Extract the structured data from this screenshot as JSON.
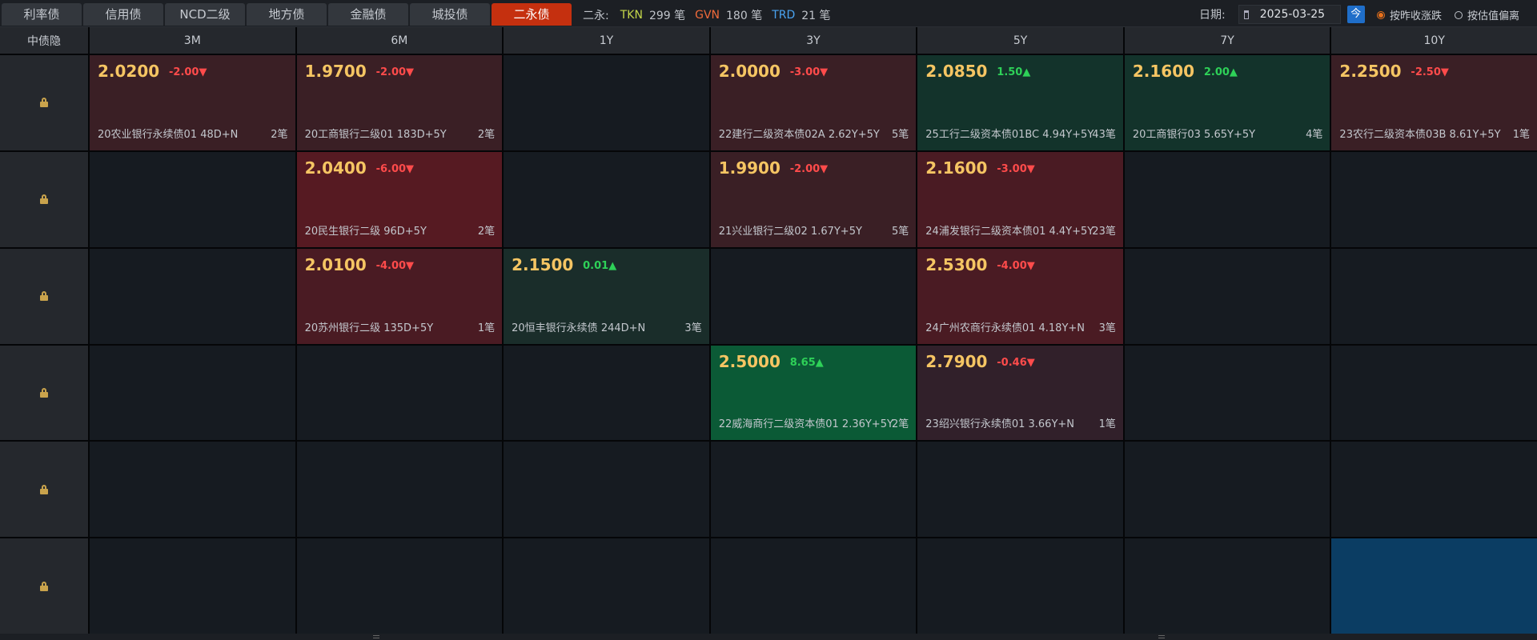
{
  "tabs": [
    {
      "label": "利率债",
      "active": false
    },
    {
      "label": "信用债",
      "active": false
    },
    {
      "label": "NCD二级",
      "active": false
    },
    {
      "label": "地方债",
      "active": false
    },
    {
      "label": "金融债",
      "active": false
    },
    {
      "label": "城投债",
      "active": false
    },
    {
      "label": "二永债",
      "active": true
    }
  ],
  "summary": {
    "label": "二永:",
    "items": [
      {
        "code": "TKN",
        "count": "299 笔",
        "color": "#c4d64a"
      },
      {
        "code": "GVN",
        "count": "180 笔",
        "color": "#f06a3a"
      },
      {
        "code": "TRD",
        "count": "21 笔",
        "color": "#4aa3f0"
      }
    ]
  },
  "date": {
    "label": "日期:",
    "value": "2025-03-25",
    "today_label": "今"
  },
  "radios": [
    {
      "label": "按昨收涨跌",
      "checked": true
    },
    {
      "label": "按估值偏离",
      "checked": false
    }
  ],
  "columns": [
    "中债隐",
    "3M",
    "6M",
    "1Y",
    "3Y",
    "5Y",
    "7Y",
    "10Y"
  ],
  "rows": [
    [
      {
        "price": "2.0200",
        "change": "-2.00▼",
        "dir": "neg",
        "name": "20农业银行永续债01 48D+N",
        "count": "2笔",
        "tone": "r1"
      },
      {
        "price": "1.9700",
        "change": "-2.00▼",
        "dir": "neg",
        "name": "20工商银行二级01 183D+5Y",
        "count": "2笔",
        "tone": "r1"
      },
      null,
      {
        "price": "2.0000",
        "change": "-3.00▼",
        "dir": "neg",
        "name": "22建行二级资本债02A 2.62Y+5Y",
        "count": "5笔",
        "tone": "r1"
      },
      {
        "price": "2.0850",
        "change": "1.50▲",
        "dir": "pos",
        "name": "25工行二级资本债01BC 4.94Y+5Y",
        "count": "43笔",
        "tone": "g1"
      },
      {
        "price": "2.1600",
        "change": "2.00▲",
        "dir": "pos",
        "name": "20工商银行03 5.65Y+5Y",
        "count": "4笔",
        "tone": "g1"
      },
      {
        "price": "2.2500",
        "change": "-2.50▼",
        "dir": "neg",
        "name": "23农行二级资本债03B 8.61Y+5Y",
        "count": "1笔",
        "tone": "r1"
      }
    ],
    [
      null,
      {
        "price": "2.0400",
        "change": "-6.00▼",
        "dir": "neg",
        "name": "20民生银行二级 96D+5Y",
        "count": "2笔",
        "tone": "r2"
      },
      null,
      {
        "price": "1.9900",
        "change": "-2.00▼",
        "dir": "neg",
        "name": "21兴业银行二级02 1.67Y+5Y",
        "count": "5笔",
        "tone": "r1"
      },
      {
        "price": "2.1600",
        "change": "-3.00▼",
        "dir": "neg",
        "name": "24浦发银行二级资本债01 4.4Y+5Y",
        "count": "23笔",
        "tone": "r3"
      },
      null,
      null
    ],
    [
      null,
      {
        "price": "2.0100",
        "change": "-4.00▼",
        "dir": "neg",
        "name": "20苏州银行二级 135D+5Y",
        "count": "1笔",
        "tone": "r3"
      },
      {
        "price": "2.1500",
        "change": "0.01▲",
        "dir": "pos",
        "name": "20恒丰银行永续债 244D+N",
        "count": "3笔",
        "tone": "g2"
      },
      null,
      {
        "price": "2.5300",
        "change": "-4.00▼",
        "dir": "neg",
        "name": "24广州农商行永续债01 4.18Y+N",
        "count": "3笔",
        "tone": "r3"
      },
      null,
      null
    ],
    [
      null,
      null,
      null,
      {
        "price": "2.5000",
        "change": "8.65▲",
        "dir": "pos",
        "name": "22威海商行二级资本债01 2.36Y+5Y",
        "count": "2笔",
        "tone": "g3"
      },
      {
        "price": "2.7900",
        "change": "-0.46▼",
        "dir": "neg",
        "name": "23绍兴银行永续债01 3.66Y+N",
        "count": "1笔",
        "tone": "rd"
      },
      null,
      null
    ],
    [
      null,
      null,
      null,
      null,
      null,
      null,
      null
    ],
    [
      null,
      null,
      null,
      null,
      null,
      null,
      "selected"
    ]
  ]
}
